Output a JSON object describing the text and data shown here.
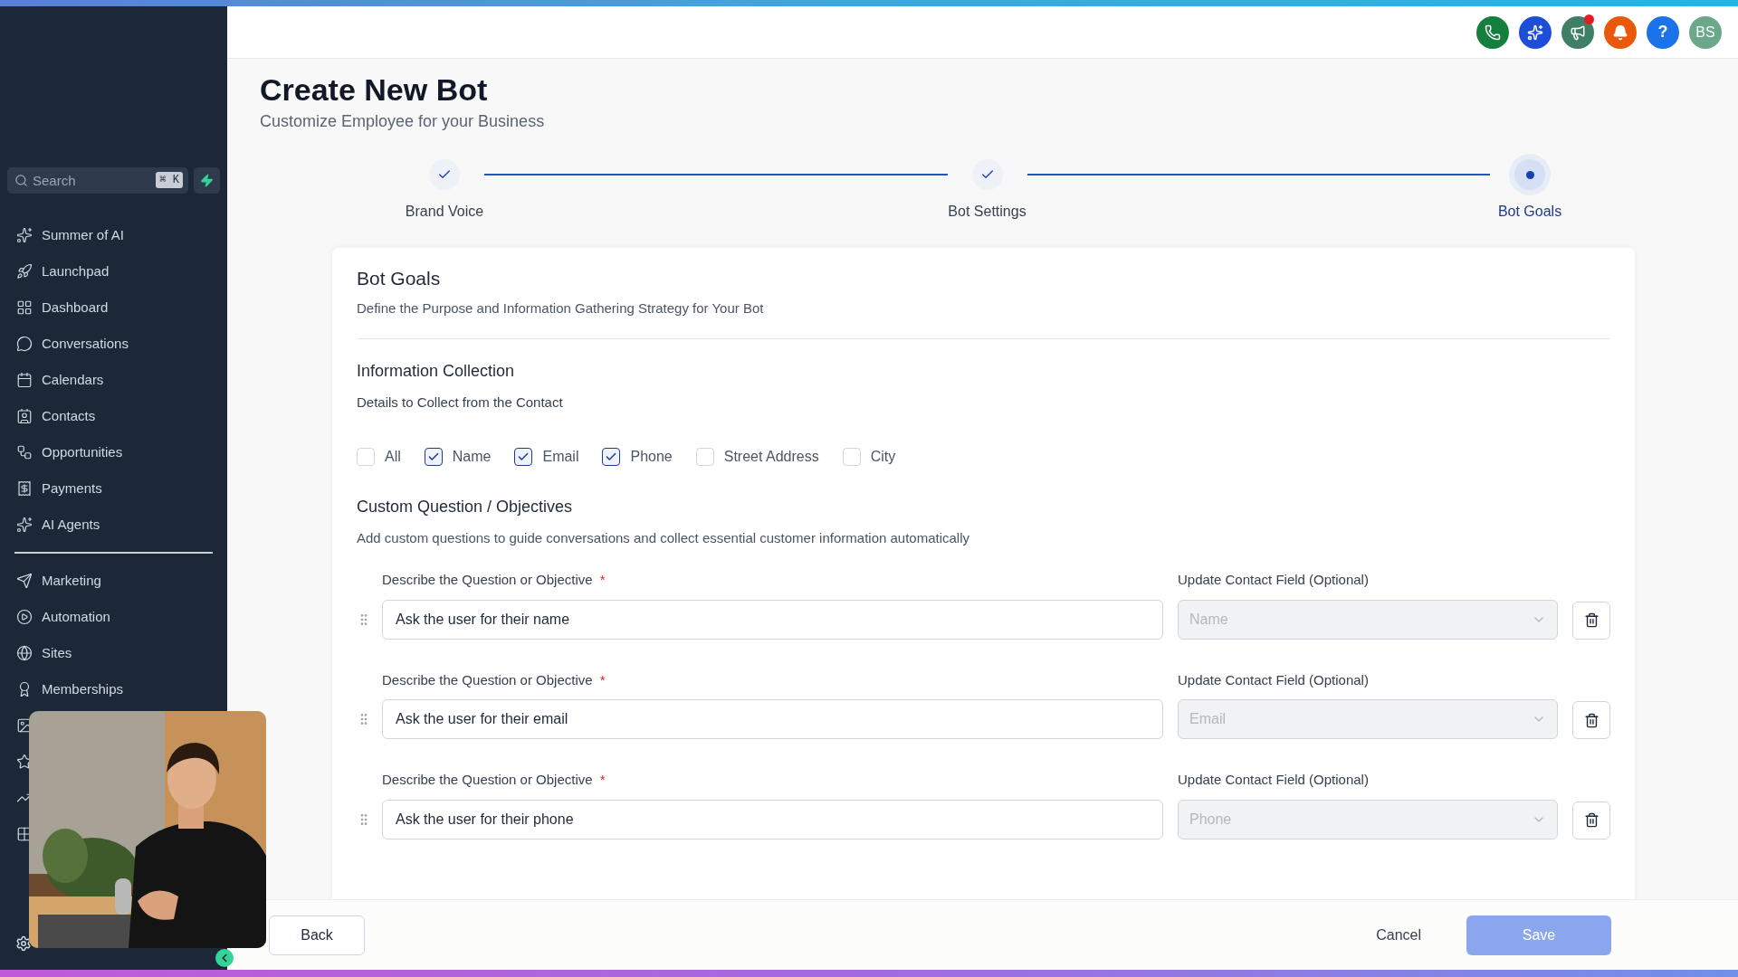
{
  "sidebar": {
    "search": {
      "placeholder": "Search",
      "shortcut": "⌘ K"
    },
    "items": [
      {
        "label": "Summer of AI"
      },
      {
        "label": "Launchpad"
      },
      {
        "label": "Dashboard"
      },
      {
        "label": "Conversations"
      },
      {
        "label": "Calendars"
      },
      {
        "label": "Contacts"
      },
      {
        "label": "Opportunities"
      },
      {
        "label": "Payments"
      },
      {
        "label": "AI Agents"
      }
    ],
    "items_2": [
      {
        "label": "Marketing"
      },
      {
        "label": "Automation"
      },
      {
        "label": "Sites"
      },
      {
        "label": "Memberships"
      }
    ]
  },
  "header_buttons": [
    {
      "kind": "phone",
      "color": "#15803d",
      "badge": false
    },
    {
      "kind": "sparkle",
      "color": "#1d4ed8",
      "badge": false
    },
    {
      "kind": "megaphone",
      "color": "#3f7f66",
      "badge": true
    },
    {
      "kind": "bell",
      "color": "#ea580c",
      "badge": false
    },
    {
      "kind": "help",
      "color": "#1a73e8",
      "badge": false,
      "label": "?"
    },
    {
      "kind": "avatar",
      "color": "#6aa889",
      "badge": false,
      "label": "BS"
    }
  ],
  "page": {
    "title": "Create New Bot",
    "subtitle": "Customize Employee for your Business"
  },
  "steps": [
    {
      "label": "Brand Voice",
      "completed": true,
      "selected": false
    },
    {
      "label": "Bot Settings",
      "completed": true,
      "selected": false
    },
    {
      "label": "Bot Goals",
      "completed": false,
      "selected": true
    }
  ],
  "card": {
    "title": "Bot Goals",
    "description": "Define the Purpose and Information Gathering Strategy for Your Bot",
    "collection": {
      "title": "Information Collection",
      "subtitle": "Details to Collect from the Contact",
      "options": [
        {
          "label": "All",
          "checked": false
        },
        {
          "label": "Name",
          "checked": true
        },
        {
          "label": "Email",
          "checked": true
        },
        {
          "label": "Phone",
          "checked": true
        },
        {
          "label": "Street Address",
          "checked": false
        },
        {
          "label": "City",
          "checked": false
        }
      ]
    },
    "custom": {
      "title": "Custom Question / Objectives",
      "description": "Add custom questions to guide conversations and collect essential customer information automatically",
      "questions": [
        {
          "label": "Describe the Question or Objective",
          "required_mark": "*",
          "value": "Ask the user for their name",
          "field_label": "Update Contact Field (Optional)",
          "field_value": "Name",
          "field_disabled": true
        },
        {
          "label": "Describe the Question or Objective",
          "required_mark": "*",
          "value": "Ask the user for their email",
          "field_label": "Update Contact Field (Optional)",
          "field_value": "Email",
          "field_disabled": true
        },
        {
          "label": "Describe the Question or Objective",
          "required_mark": "*",
          "value": "Ask the user for their phone",
          "field_label": "Update Contact Field (Optional)",
          "field_value": "Phone",
          "field_disabled": true
        }
      ]
    }
  },
  "footer": {
    "back": "Back",
    "cancel": "Cancel",
    "save": {
      "label": "Save",
      "disabled": true
    }
  }
}
